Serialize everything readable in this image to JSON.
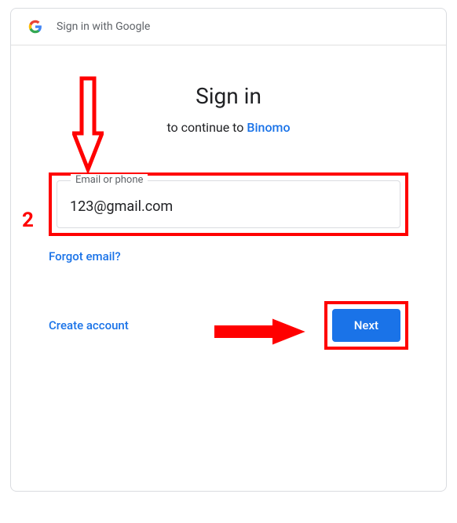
{
  "header": {
    "title": "Sign in with Google"
  },
  "main": {
    "title": "Sign in",
    "continuePrefix": "to continue to ",
    "appName": "Binomo",
    "emailLabel": "Email or phone",
    "emailValue": "123@gmail.com",
    "forgotLabel": "Forgot email?",
    "createLabel": "Create account",
    "nextLabel": "Next"
  },
  "annotation": {
    "stepNumber": "2"
  }
}
